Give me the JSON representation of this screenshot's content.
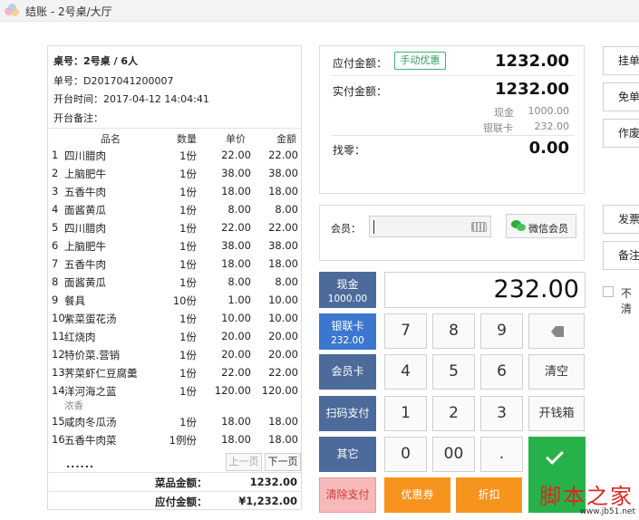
{
  "window": {
    "title": "结账 - 2号桌/大厅"
  },
  "receipt": {
    "table": "桌号：2号桌 / 6人",
    "order_no": "单号：D2017041200007",
    "open_time": "开台时间：2017-04-12 14:04:41",
    "open_note": "开台备注：",
    "headers": {
      "name": "品名",
      "qty": "数量",
      "price": "单价",
      "amount": "金额"
    },
    "items": [
      {
        "no": "1",
        "name": "四川腊肉",
        "qty": "1份",
        "price": "22.00",
        "amount": "22.00"
      },
      {
        "no": "2",
        "name": "上脑肥牛",
        "qty": "1份",
        "price": "38.00",
        "amount": "38.00"
      },
      {
        "no": "3",
        "name": "五香牛肉",
        "qty": "1份",
        "price": "18.00",
        "amount": "18.00"
      },
      {
        "no": "4",
        "name": "面酱黄瓜",
        "qty": "1份",
        "price": "8.00",
        "amount": "8.00"
      },
      {
        "no": "5",
        "name": "四川腊肉",
        "qty": "1份",
        "price": "22.00",
        "amount": "22.00"
      },
      {
        "no": "6",
        "name": "上脑肥牛",
        "qty": "1份",
        "price": "38.00",
        "amount": "38.00"
      },
      {
        "no": "7",
        "name": "五香牛肉",
        "qty": "1份",
        "price": "18.00",
        "amount": "18.00"
      },
      {
        "no": "8",
        "name": "面酱黄瓜",
        "qty": "1份",
        "price": "8.00",
        "amount": "8.00"
      },
      {
        "no": "9",
        "name": "餐具",
        "qty": "10份",
        "price": "1.00",
        "amount": "10.00"
      },
      {
        "no": "10",
        "name": "紫菜蛋花汤",
        "qty": "1份",
        "price": "10.00",
        "amount": "10.00"
      },
      {
        "no": "11",
        "name": "红烧肉",
        "qty": "1份",
        "price": "20.00",
        "amount": "20.00"
      },
      {
        "no": "12",
        "name": "特价菜.营销",
        "qty": "1份",
        "price": "20.00",
        "amount": "20.00"
      },
      {
        "no": "13",
        "name": "荠菜虾仁豆腐羹",
        "qty": "1份",
        "price": "22.00",
        "amount": "22.00"
      },
      {
        "no": "14",
        "name": "洋河海之蓝",
        "qty": "1份",
        "price": "120.00",
        "amount": "120.00",
        "remark": "浓香"
      },
      {
        "no": "15",
        "name": "咸肉冬瓜汤",
        "qty": "1份",
        "price": "18.00",
        "amount": "18.00"
      },
      {
        "no": "16",
        "name": "五香牛肉菜",
        "qty": "1例份",
        "price": "18.00",
        "amount": "18.00"
      }
    ],
    "more": "......",
    "prev_page": "上一页",
    "next_page": "下一页",
    "dish_total_label": "菜品金额：",
    "dish_total": "1232.00",
    "payable_label": "应付金额：",
    "payable": "¥1,232.00"
  },
  "payment": {
    "due_label": "应付金额：",
    "manual_discount": "手动优惠",
    "due": "1232.00",
    "paid_label": "实付金额：",
    "paid": "1232.00",
    "cash_label": "现金",
    "cash": "1000.00",
    "unionpay_label": "银联卡",
    "unionpay": "232.00",
    "change_label": "找零：",
    "change": "0.00"
  },
  "member": {
    "label": "会员：",
    "input_value": "",
    "wechat_button": "微信会员"
  },
  "methods": {
    "cash": {
      "label": "现金",
      "amount": "1000.00"
    },
    "unionpay": {
      "label": "银联卡",
      "amount": "232.00"
    },
    "member_card": "会员卡",
    "scan_pay": "扫码支付",
    "other": "其它",
    "clear_pay": "清除支付"
  },
  "display": {
    "value": "232.00"
  },
  "keypad": {
    "k7": "7",
    "k8": "8",
    "k9": "9",
    "k4": "4",
    "k5": "5",
    "k6": "6",
    "k1": "1",
    "k2": "2",
    "k3": "3",
    "k0": "0",
    "k00": "00",
    "kdot": ".",
    "clear": "清空",
    "cash_drawer": "开钱箱",
    "coupon": "优惠券",
    "discount": "折扣"
  },
  "side": {
    "hang": "挂单",
    "free": "免单",
    "void": "作废",
    "invoice": "发票",
    "note": "备注",
    "checkbox_label": "不清"
  },
  "watermark": {
    "main": "脚本之家",
    "sub": "www.jb51.net"
  },
  "colors": {
    "method_blue": "#4d6b9a",
    "active_blue": "#3c77cf",
    "confirm_green": "#27b14a",
    "orange": "#f7941d",
    "danger_text": "#d23b3b"
  }
}
